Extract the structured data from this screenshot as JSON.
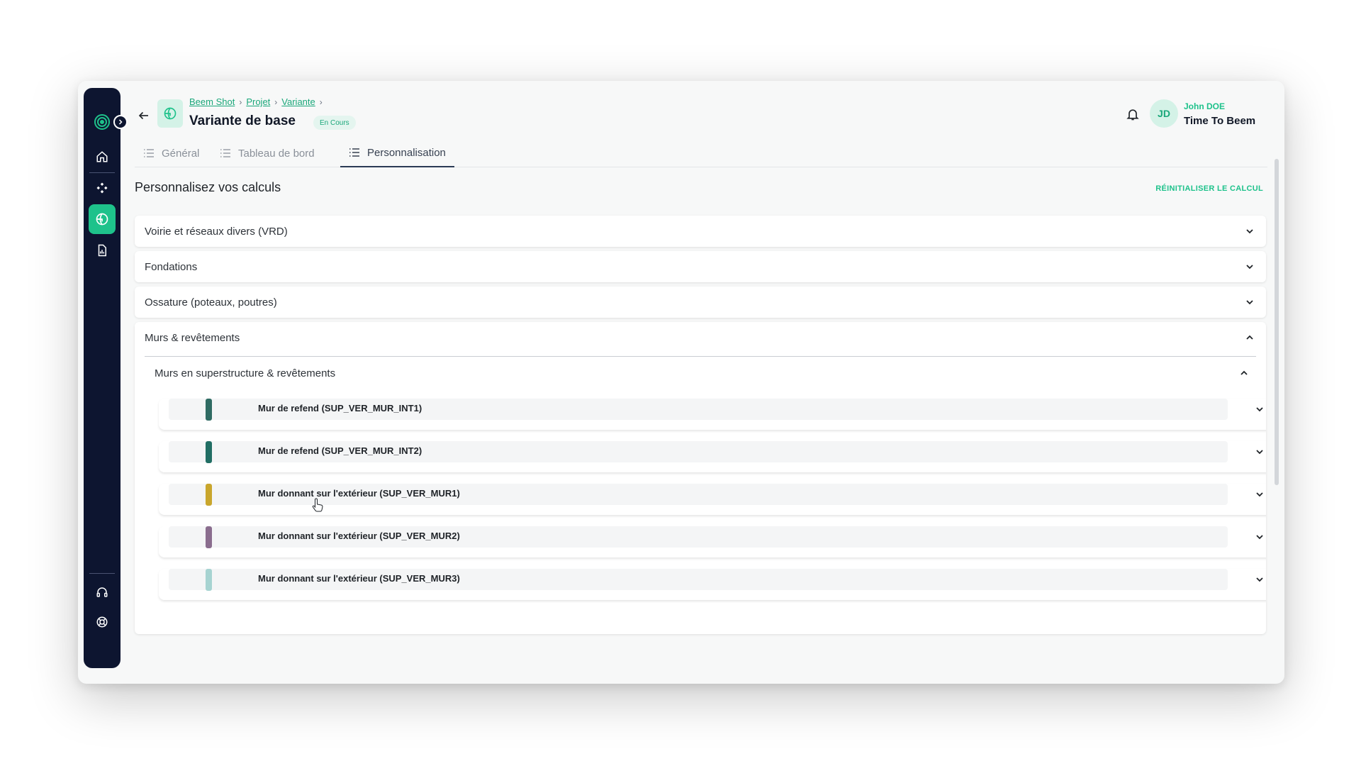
{
  "header": {
    "breadcrumb": [
      "Beem Shot",
      "Projet",
      "Variante"
    ],
    "title": "Variante de base",
    "status": "En Cours",
    "user_name": "John DOE",
    "user_org": "Time To Beem",
    "avatar_initials": "JD"
  },
  "tabs": [
    {
      "label": "Général",
      "active": false
    },
    {
      "label": "Tableau de bord",
      "active": false
    },
    {
      "label": "Personnalisation",
      "active": true
    }
  ],
  "main": {
    "title": "Personnalisez vos calculs",
    "reset_label": "RÉINITIALISER LE CALCUL",
    "sections": [
      {
        "label": "Voirie et réseaux divers (VRD)",
        "expanded": false
      },
      {
        "label": "Fondations",
        "expanded": false
      },
      {
        "label": "Ossature (poteaux, poutres)",
        "expanded": false
      },
      {
        "label": "Murs & revêtements",
        "expanded": true
      }
    ],
    "subsection": "Murs en superstructure & revêtements",
    "items": [
      {
        "label": "Mur de refend (SUP_VER_MUR_INT1)",
        "color": "#2f6b63"
      },
      {
        "label": "Mur de refend (SUP_VER_MUR_INT2)",
        "color": "#216e64"
      },
      {
        "label": "Mur donnant sur l'extérieur (SUP_VER_MUR1)",
        "color": "#c9a62c"
      },
      {
        "label": "Mur donnant sur l'extérieur (SUP_VER_MUR2)",
        "color": "#8a6d8e"
      },
      {
        "label": "Mur donnant sur l'extérieur (SUP_VER_MUR3)",
        "color": "#a6d3d1"
      }
    ]
  },
  "colors": {
    "accent": "#1ec28b",
    "sidebar": "#0d1530"
  },
  "icons": {
    "sidebar": [
      "logo-icon",
      "home-icon",
      "components-icon",
      "variant-icon",
      "report-icon",
      "headset-icon",
      "help-icon"
    ],
    "header": [
      "back-arrow-icon",
      "bell-icon"
    ]
  }
}
